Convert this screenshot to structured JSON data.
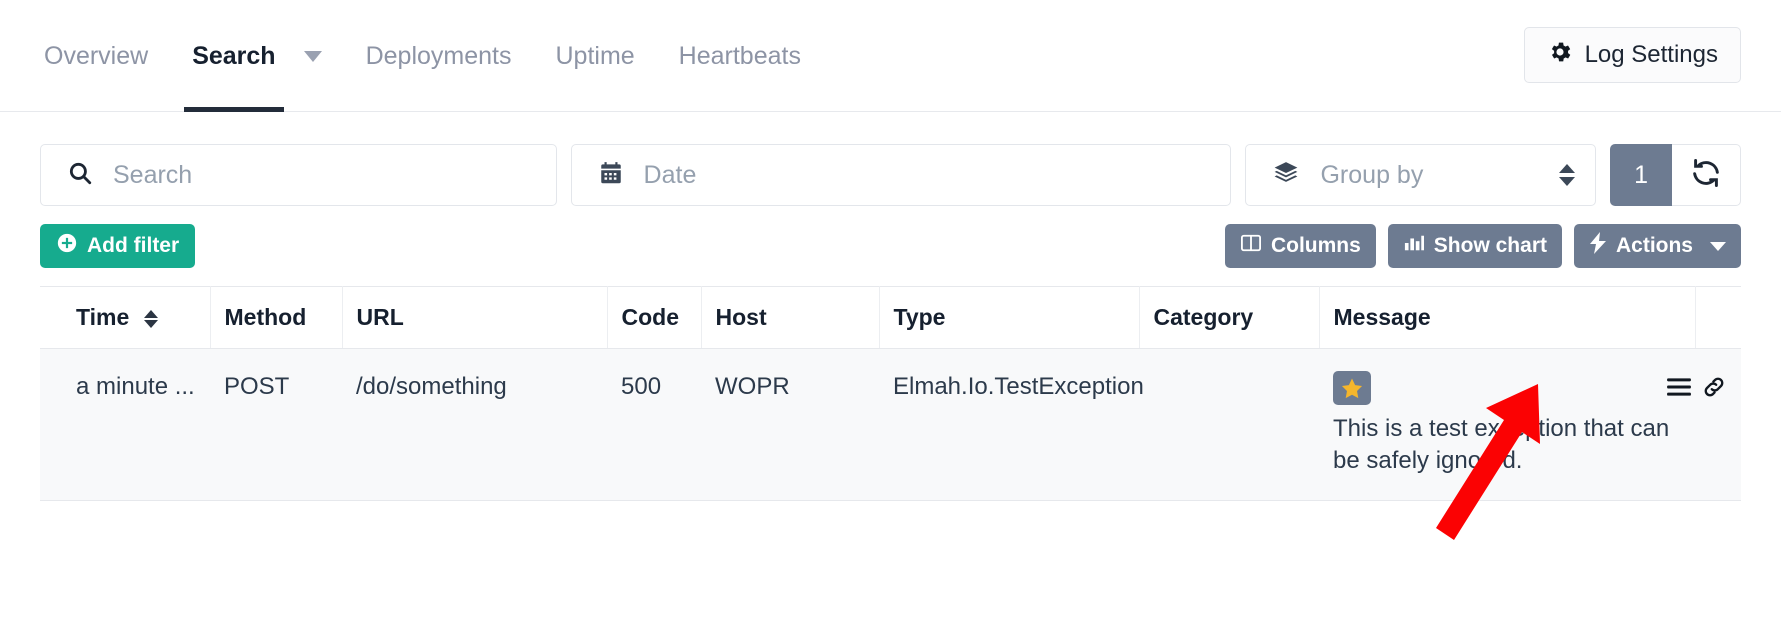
{
  "nav": {
    "tabs": [
      {
        "label": "Overview",
        "active": false,
        "has_caret": false
      },
      {
        "label": "Search",
        "active": true,
        "has_caret": true
      },
      {
        "label": "Deployments",
        "active": false,
        "has_caret": false
      },
      {
        "label": "Uptime",
        "active": false,
        "has_caret": false
      },
      {
        "label": "Heartbeats",
        "active": false,
        "has_caret": false
      }
    ],
    "log_settings_label": "Log Settings",
    "log_settings_icon": "gear-icon"
  },
  "filters": {
    "search_placeholder": "Search",
    "search_value": "",
    "search_icon": "search-icon",
    "date_placeholder": "Date",
    "date_value": "",
    "date_icon": "calendar-icon",
    "groupby_label": "Group by",
    "groupby_icon": "layers-icon",
    "page_count": "1",
    "refresh_icon": "refresh-icon"
  },
  "actions": {
    "add_filter_label": "Add filter",
    "add_filter_icon": "plus-circle-icon",
    "columns_label": "Columns",
    "columns_icon": "columns-icon",
    "show_chart_label": "Show chart",
    "show_chart_icon": "bar-chart-icon",
    "actions_label": "Actions",
    "actions_icon": "bolt-icon"
  },
  "table": {
    "columns": [
      "Time",
      "Method",
      "URL",
      "Code",
      "Host",
      "Type",
      "Category",
      "Message"
    ],
    "sorted_column": "Time",
    "rows": [
      {
        "time": "a minute ...",
        "method": "POST",
        "url": "/do/something",
        "code": "500",
        "host": "WOPR",
        "type": "Elmah.Io.TestException",
        "category": "",
        "message_badge_icon": "star-icon",
        "message": "This is a test exception that can be safely ignored.",
        "row_icons": [
          "list-icon",
          "link-icon"
        ],
        "severity_color": "#ea6352"
      }
    ]
  },
  "colors": {
    "accent_teal": "#16ab8e",
    "slate": "#6d7b91",
    "error_red": "#ea6352",
    "star_gold": "#f5b62c",
    "annotation_red": "#fb0203"
  },
  "annotation": {
    "arrow_label": "arrow pointing to link icon",
    "color": "#fb0203"
  }
}
